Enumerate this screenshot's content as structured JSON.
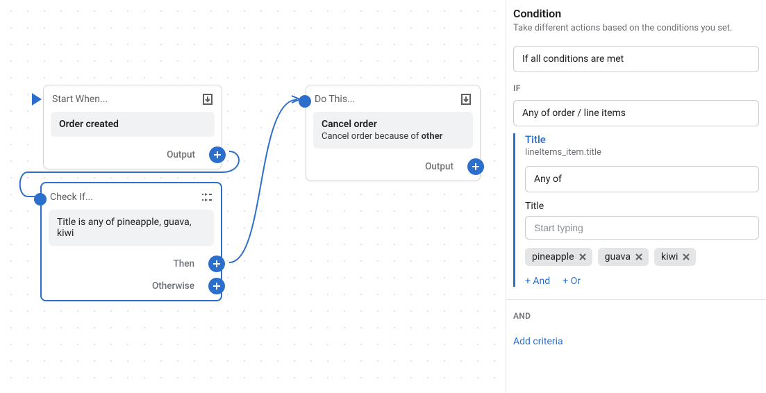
{
  "nodes": {
    "start": {
      "title": "Start When...",
      "body_strong": "Order created",
      "output_label": "Output"
    },
    "check": {
      "title": "Check If...",
      "body_text": "Title is any of pineapple, guava, kiwi",
      "then_label": "Then",
      "otherwise_label": "Otherwise"
    },
    "action": {
      "title": "Do This...",
      "body_strong": "Cancel order",
      "body_sub_prefix": "Cancel order because of ",
      "body_sub_strong": "other",
      "output_label": "Output"
    }
  },
  "panel": {
    "title": "Condition",
    "subtitle": "Take different actions based on the conditions you set.",
    "mode_select": "If all conditions are met",
    "if_label": "IF",
    "scope_select": "Any of order / line items",
    "criteria": {
      "title": "Title",
      "path": "lineItems_item.title",
      "operator": "Any of",
      "value_label": "Title",
      "value_placeholder": "Start typing",
      "tags": [
        "pineapple",
        "guava",
        "kiwi"
      ],
      "add_and": "+ And",
      "add_or": "+ Or"
    },
    "and_label": "AND",
    "add_criteria": "Add criteria"
  }
}
